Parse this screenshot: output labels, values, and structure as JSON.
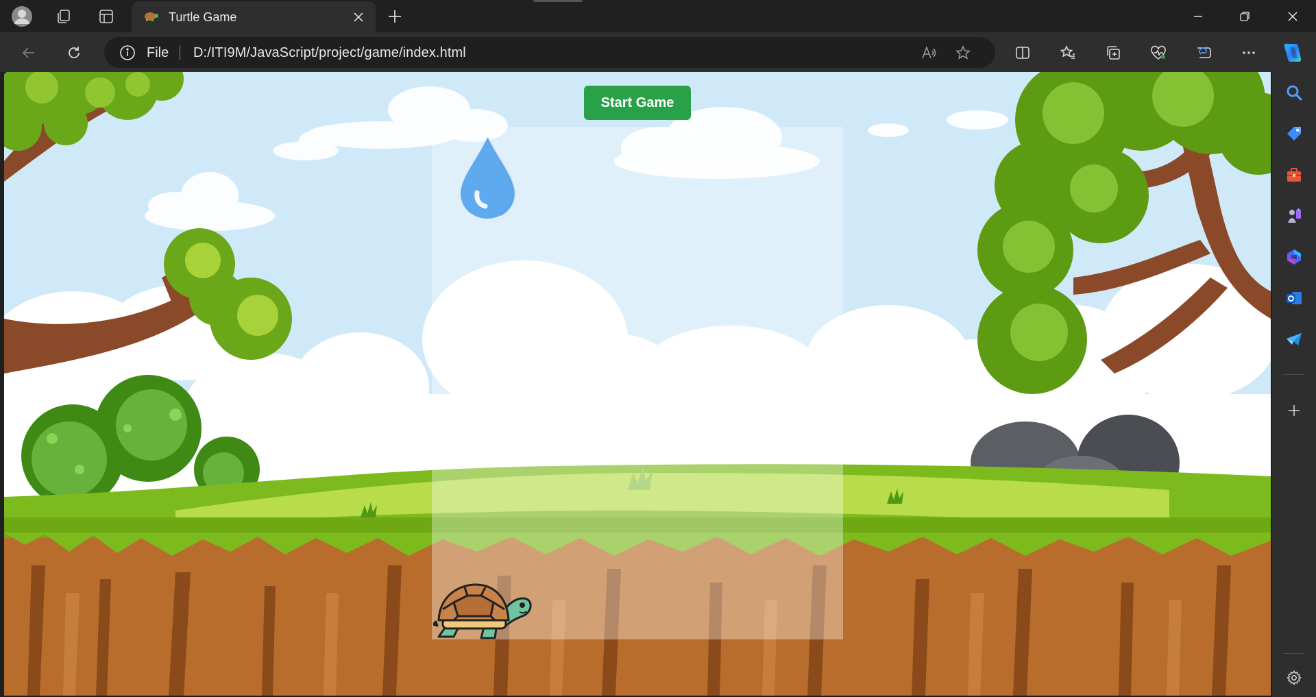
{
  "browser": {
    "tab": {
      "title": "Turtle Game"
    },
    "address": {
      "scheme": "File",
      "url": "D:/ITI9M/JavaScript/project/game/index.html"
    }
  },
  "page": {
    "start_button": "Start Game"
  },
  "colors": {
    "chrome_dark": "#202020",
    "toolbar": "#2e2e2e",
    "sky": "#cfe9f8",
    "start_button": "#28a149",
    "water_drop": "#5fa9ee",
    "grass": "#7dba1e",
    "dirt": "#b86d2c"
  },
  "icons": {
    "titlebar": [
      "profile-avatar-icon",
      "collections-icon",
      "vertical-tabs-icon"
    ],
    "toolbar": [
      "back-icon",
      "refresh-icon",
      "info-icon",
      "read-aloud-icon",
      "favorite-star-icon",
      "split-screen-icon",
      "favorites-icon",
      "collections-icon",
      "browser-essentials-icon",
      "performance-icon",
      "more-icon",
      "copilot-icon"
    ],
    "sidebar": [
      "search-icon",
      "shopping-tag-icon",
      "tools-icon",
      "games-icon",
      "microsoft-365-icon",
      "outlook-icon",
      "telegram-icon",
      "add-icon",
      "settings-icon"
    ],
    "game": [
      "water-drop-icon",
      "turtle-icon"
    ]
  }
}
